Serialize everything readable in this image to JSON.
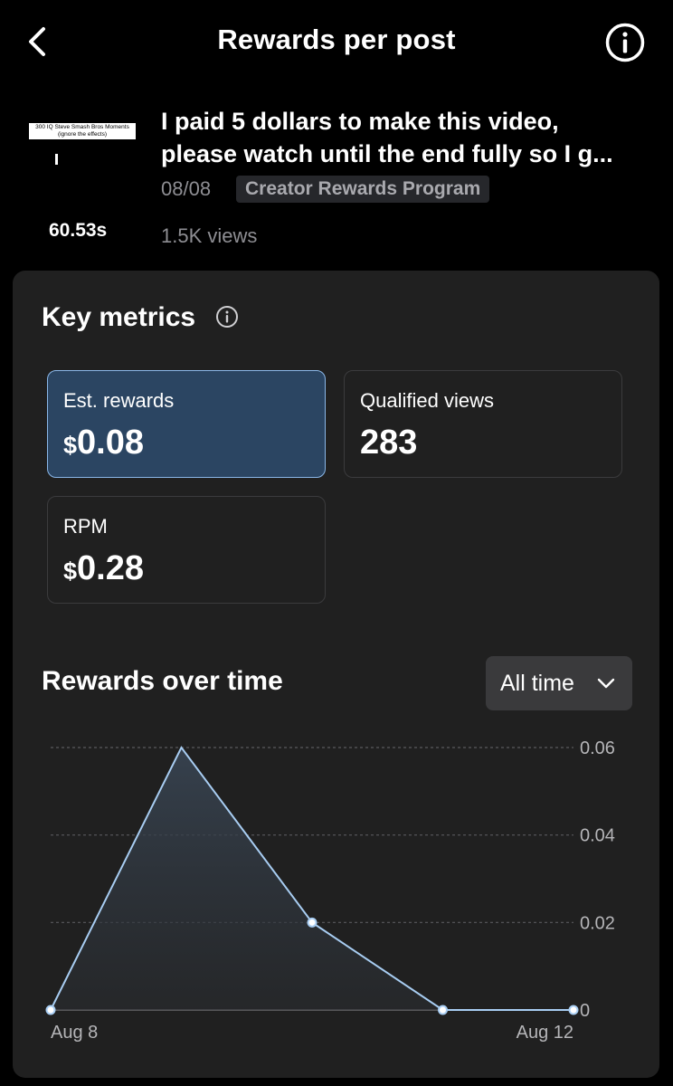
{
  "header": {
    "title": "Rewards per post",
    "back_icon": "chevron-left-icon",
    "info_icon": "info-circle-icon"
  },
  "post": {
    "thumbnail_caption_line1": "300 IQ Steve Smash Bros Moments",
    "thumbnail_caption_line2": "(ignore the effects)",
    "duration": "60.53s",
    "title_line1": "I paid 5 dollars to make this video,",
    "title_line2": "please watch until the end fully so I g...",
    "date": "08/08",
    "program": "Creator Rewards Program",
    "views": "1.5K views"
  },
  "key_metrics": {
    "title": "Key metrics",
    "info_icon": "info-circle-icon",
    "cards": [
      {
        "label": "Est. rewards",
        "currency": "$",
        "value": "0.08",
        "selected": true
      },
      {
        "label": "Qualified views",
        "currency": "",
        "value": "283",
        "selected": false
      },
      {
        "label": "RPM",
        "currency": "$",
        "value": "0.28",
        "selected": false
      }
    ]
  },
  "rewards_over_time": {
    "title": "Rewards over time",
    "range_selected": "All time",
    "range_icon": "chevron-down-icon"
  },
  "colors": {
    "background": "#000000",
    "panel": "#202020",
    "accent_line": "#a8cdf2",
    "selected_card": "#2b4562",
    "selected_border": "#8ab7e8"
  },
  "chart_data": {
    "type": "area",
    "x": [
      "Aug 8",
      "Aug 9",
      "Aug 10",
      "Aug 11",
      "Aug 12"
    ],
    "x_tick_labels": [
      "Aug 8",
      "Aug 12"
    ],
    "values": [
      0,
      0.06,
      0.02,
      0,
      0
    ],
    "y_ticks": [
      "0.06",
      "0.04",
      "0.02",
      "0"
    ],
    "ylim": [
      0,
      0.06
    ],
    "grid": "dashed horizontal",
    "y_axis_side": "right"
  }
}
